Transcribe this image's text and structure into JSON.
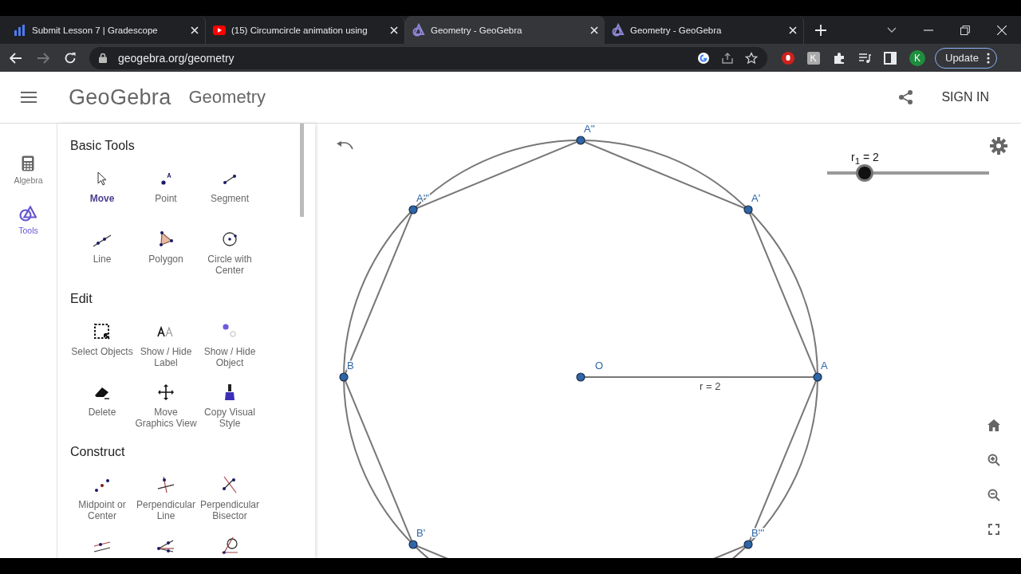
{
  "browser": {
    "tabs": [
      {
        "title": "Submit Lesson 7 | Gradescope",
        "selected": false
      },
      {
        "title": "(15) Circumcircle animation using",
        "selected": false
      },
      {
        "title": "Geometry - GeoGebra",
        "selected": true
      },
      {
        "title": "Geometry - GeoGebra",
        "selected": false
      }
    ],
    "url": "geogebra.org/geometry",
    "profile": "K",
    "update_button": "Update"
  },
  "header": {
    "logo": "GeoGebra",
    "app_title": "Geometry",
    "sign_in": "SIGN IN"
  },
  "rail": [
    {
      "label": "Algebra",
      "selected": false
    },
    {
      "label": "Tools",
      "selected": true
    }
  ],
  "tool_sections": [
    {
      "title": "Basic Tools",
      "tools": [
        {
          "label": "Move",
          "selected": true
        },
        {
          "label": "Point",
          "selected": false
        },
        {
          "label": "Segment",
          "selected": false
        },
        {
          "label": "Line",
          "selected": false
        },
        {
          "label": "Polygon",
          "selected": false
        },
        {
          "label": "Circle with Center",
          "selected": false
        }
      ]
    },
    {
      "title": "Edit",
      "tools": [
        {
          "label": "Select Objects",
          "selected": false
        },
        {
          "label": "Show / Hide Label",
          "selected": false
        },
        {
          "label": "Show / Hide Object",
          "selected": false
        },
        {
          "label": "Delete",
          "selected": false
        },
        {
          "label": "Move Graphics View",
          "selected": false
        },
        {
          "label": "Copy Visual Style",
          "selected": false
        }
      ]
    },
    {
      "title": "Construct",
      "tools": [
        {
          "label": "Midpoint or Center",
          "selected": false
        },
        {
          "label": "Perpendicular Line",
          "selected": false
        },
        {
          "label": "Perpendicular Bisector",
          "selected": false
        },
        {
          "selected": false
        },
        {
          "selected": false
        },
        {
          "selected": false
        }
      ]
    }
  ],
  "canvas": {
    "center_label": "O",
    "radius_label": "r = 2",
    "points": [
      {
        "label": "A"
      },
      {
        "label": "A'"
      },
      {
        "label": "A''"
      },
      {
        "label": "A'''"
      },
      {
        "label": "B"
      },
      {
        "label": "B'"
      },
      {
        "label": "B'''"
      }
    ],
    "slider": {
      "label": "r$_{1}$ = 2",
      "level": 0.2
    }
  }
}
